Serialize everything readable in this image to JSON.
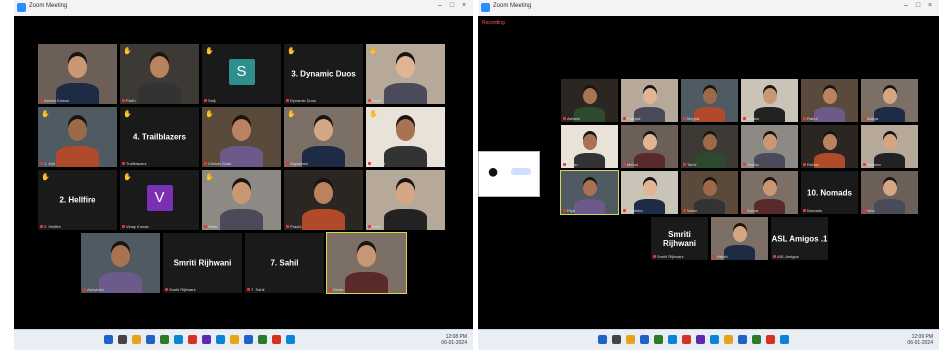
{
  "left_window": {
    "title": "Zoom Meeting",
    "tiles_row1": [
      {
        "kind": "video",
        "label": "Ashish Kumar",
        "hand": false
      },
      {
        "kind": "video",
        "label": "Parth",
        "hand": true
      },
      {
        "kind": "avatar",
        "letter": "S",
        "label": "Saiji",
        "hand": true,
        "color": "#2f8f8f"
      },
      {
        "kind": "text",
        "big": "3. Dynamic Duos",
        "label": "Dynamic Duos",
        "hand": true
      },
      {
        "kind": "video",
        "label": "Vidhi",
        "hand": true
      }
    ],
    "tiles_row2": [
      {
        "kind": "video",
        "label": "1. Arjit",
        "hand": true
      },
      {
        "kind": "text",
        "big": "4. Trailblazers",
        "label": "Trailblazers",
        "hand": true
      },
      {
        "kind": "video",
        "label": "Chetan Shah",
        "hand": true
      },
      {
        "kind": "video",
        "label": "Sayantani",
        "hand": true
      },
      {
        "kind": "video",
        "label": "1. Ankit",
        "hand": true
      }
    ],
    "tiles_row3": [
      {
        "kind": "text",
        "big": "2. Hellfire",
        "label": "2. Hellfire",
        "hand": true
      },
      {
        "kind": "avatar",
        "letter": "V",
        "label": "Vinay Kumar",
        "hand": true,
        "color": "#7a2fb4"
      },
      {
        "kind": "video",
        "label": "Nihar",
        "hand": true
      },
      {
        "kind": "video",
        "label": "Prachi",
        "hand": false
      },
      {
        "kind": "video",
        "label": "Kabir",
        "hand": false
      }
    ],
    "tiles_row4": [
      {
        "kind": "video",
        "label": "Ashutosh",
        "hand": false
      },
      {
        "kind": "text",
        "big": "Smriti Rijhwani",
        "label": "Smriti Rijhwani",
        "hand": false
      },
      {
        "kind": "text",
        "big": "7. Sahil",
        "label": "7. Sahil",
        "hand": false
      },
      {
        "kind": "video",
        "label": "Disha",
        "hand": false,
        "speaking": true
      }
    ],
    "taskbar": {
      "time": "12:08 PM",
      "date": "06-01-2024"
    }
  },
  "right_window": {
    "title": "Zoom Meeting",
    "recording": "Recording",
    "grid": [
      {
        "kind": "video",
        "label": "Ashwin"
      },
      {
        "kind": "video",
        "label": "Pranjali"
      },
      {
        "kind": "video",
        "label": "Megha"
      },
      {
        "kind": "video",
        "label": "Ishaan"
      },
      {
        "kind": "video",
        "label": "Rahul"
      },
      {
        "kind": "video",
        "label": "Aditya"
      },
      {
        "kind": "video",
        "label": "Karan"
      },
      {
        "kind": "video",
        "label": "Mehul"
      },
      {
        "kind": "video",
        "label": "Tanvi"
      },
      {
        "kind": "video",
        "label": "Sneha"
      },
      {
        "kind": "video",
        "label": "Rohan"
      },
      {
        "kind": "video",
        "label": "Sameer"
      },
      {
        "kind": "video",
        "label": "Riya",
        "speaking": true
      },
      {
        "kind": "video",
        "label": "Anushka"
      },
      {
        "kind": "video",
        "label": "Varun"
      },
      {
        "kind": "video",
        "label": "Kavya"
      },
      {
        "kind": "text",
        "big": "10. Nomads",
        "label": "Nomads"
      },
      {
        "kind": "video",
        "label": "Isha"
      }
    ],
    "bottom": [
      {
        "kind": "text",
        "big": "Smriti Rijhwani",
        "label": "Smriti Rijhwani"
      },
      {
        "kind": "video",
        "label": "Harsh"
      },
      {
        "kind": "text",
        "big": "ASL Amigos .1",
        "label": "ASL Amigos"
      }
    ],
    "taskbar": {
      "time": "12:09 PM",
      "date": "06-01-2024"
    }
  }
}
